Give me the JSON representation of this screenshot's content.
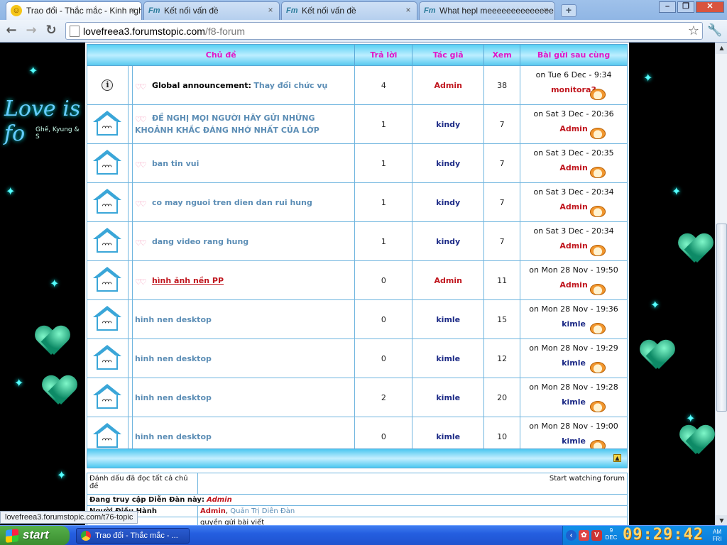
{
  "browser": {
    "tabs": [
      {
        "title": "Trao đổi - Thắc mắc - Kinh nghi",
        "icon": "smiley-favicon-icon",
        "active": true
      },
      {
        "title": "Kết nối vấn đề",
        "icon": "forumotion-favicon-icon",
        "active": false
      },
      {
        "title": "Kết nối vấn đề",
        "icon": "forumotion-favicon-icon",
        "active": false
      },
      {
        "title": "What hepl meeeeeeeeeeeeee",
        "icon": "forumotion-favicon-icon",
        "active": false
      }
    ],
    "favicon_fm": "Fm",
    "tab_close": "×",
    "new_tab": "+",
    "window_buttons": {
      "minimize": "–",
      "restore": "❐",
      "close": "✕"
    },
    "nav": {
      "back": "←",
      "forward": "→",
      "reload": "↻"
    },
    "url_host": "lovefreea3.forumstopic.com",
    "url_path": "/f8-forum",
    "star": "☆",
    "wrench": "🔧"
  },
  "decoration": {
    "left_text": "Love is fo",
    "left_sub": "Ghế, Kyung & S"
  },
  "forum": {
    "headers": {
      "topic": "Chủ đề",
      "replies": "Trả lời",
      "author": "Tác giả",
      "views": "Xem",
      "last_post": "Bài gửi sau cùng"
    },
    "topics": [
      {
        "kind": "announcement",
        "prefix": "Global announcement:",
        "title": "Thay đổi chức vụ",
        "replies": "4",
        "author": "Admin",
        "author_admin": true,
        "views": "38",
        "last_date": "on Tue 6 Dec - 9:34",
        "last_user": "monitora3",
        "last_user_admin": true,
        "wings": true
      },
      {
        "kind": "normal",
        "prefix": "",
        "title": "ĐỀ NGHỊ MỌI NGƯỜI HÃY GỬI NHỮNG KHOẢNH KHẮC ĐÁNG NHỚ NHẤT CỦA LỚP",
        "replies": "1",
        "author": "kindy",
        "author_admin": false,
        "views": "7",
        "last_date": "on Sat 3 Dec - 20:36",
        "last_user": "Admin",
        "last_user_admin": true,
        "wings": true
      },
      {
        "kind": "normal",
        "prefix": "",
        "title": "ban tin vui",
        "replies": "1",
        "author": "kindy",
        "author_admin": false,
        "views": "7",
        "last_date": "on Sat 3 Dec - 20:35",
        "last_user": "Admin",
        "last_user_admin": true,
        "wings": true
      },
      {
        "kind": "normal",
        "prefix": "",
        "title": "co may nguoi tren dien dan rui hung",
        "replies": "1",
        "author": "kindy",
        "author_admin": false,
        "views": "7",
        "last_date": "on Sat 3 Dec - 20:34",
        "last_user": "Admin",
        "last_user_admin": true,
        "wings": true
      },
      {
        "kind": "normal",
        "prefix": "",
        "title": "dang video rang hung",
        "replies": "1",
        "author": "kindy",
        "author_admin": false,
        "views": "7",
        "last_date": "on Sat 3 Dec - 20:34",
        "last_user": "Admin",
        "last_user_admin": true,
        "wings": true
      },
      {
        "kind": "red",
        "prefix": "",
        "title": "hình ảnh nền PP",
        "replies": "0",
        "author": "Admin",
        "author_admin": true,
        "views": "11",
        "last_date": "on Mon 28 Nov - 19:50",
        "last_user": "Admin",
        "last_user_admin": true,
        "wings": true
      },
      {
        "kind": "normal",
        "prefix": "",
        "title": "hinh nen desktop",
        "replies": "0",
        "author": "kimle",
        "author_admin": false,
        "views": "15",
        "last_date": "on Mon 28 Nov - 19:36",
        "last_user": "kimle",
        "last_user_admin": false,
        "wings": false
      },
      {
        "kind": "normal",
        "prefix": "",
        "title": "hinh nen desktop",
        "replies": "0",
        "author": "kimle",
        "author_admin": false,
        "views": "12",
        "last_date": "on Mon 28 Nov - 19:29",
        "last_user": "kimle",
        "last_user_admin": false,
        "wings": false
      },
      {
        "kind": "normal",
        "prefix": "",
        "title": "hinh nen desktop",
        "replies": "2",
        "author": "kimle",
        "author_admin": false,
        "views": "20",
        "last_date": "on Mon 28 Nov - 19:28",
        "last_user": "kimle",
        "last_user_admin": false,
        "wings": false
      },
      {
        "kind": "normal",
        "prefix": "",
        "title": "hinh nen desktop",
        "replies": "0",
        "author": "kimle",
        "author_admin": false,
        "views": "10",
        "last_date": "on Mon 28 Nov - 19:00",
        "last_user": "kimle",
        "last_user_admin": false,
        "wings": false
      }
    ],
    "scroll_top": "▲",
    "mark_read": "Đánh dấu đã đọc tất cả chủ đề",
    "watch_forum": "Start watching forum",
    "browsing_label": "Đang truy cập Diễn Đàn này:",
    "browsing_user": "Admin",
    "moderator_label": "Người Điều Hành",
    "moderator_user": "Admin",
    "moderator_role": "Quản Trị Diễn Đàn",
    "permissions_text": "quyền gửi bài viết"
  },
  "status_bar": "lovefreea3.forumstopic.com/t76-topic",
  "taskbar": {
    "start": "start",
    "task_title": "Trao đổi - Thắc mắc - ...",
    "tray_v": "V",
    "date_day": "9",
    "date_month": "DEC",
    "clock": "09:29:42",
    "ampm": "AM",
    "weekday": "FRI"
  },
  "colors": {
    "header_text": "#e016c8",
    "topic_blue": "#5b8db5",
    "admin_red": "#c0161e",
    "author_navy": "#1c2a86"
  }
}
